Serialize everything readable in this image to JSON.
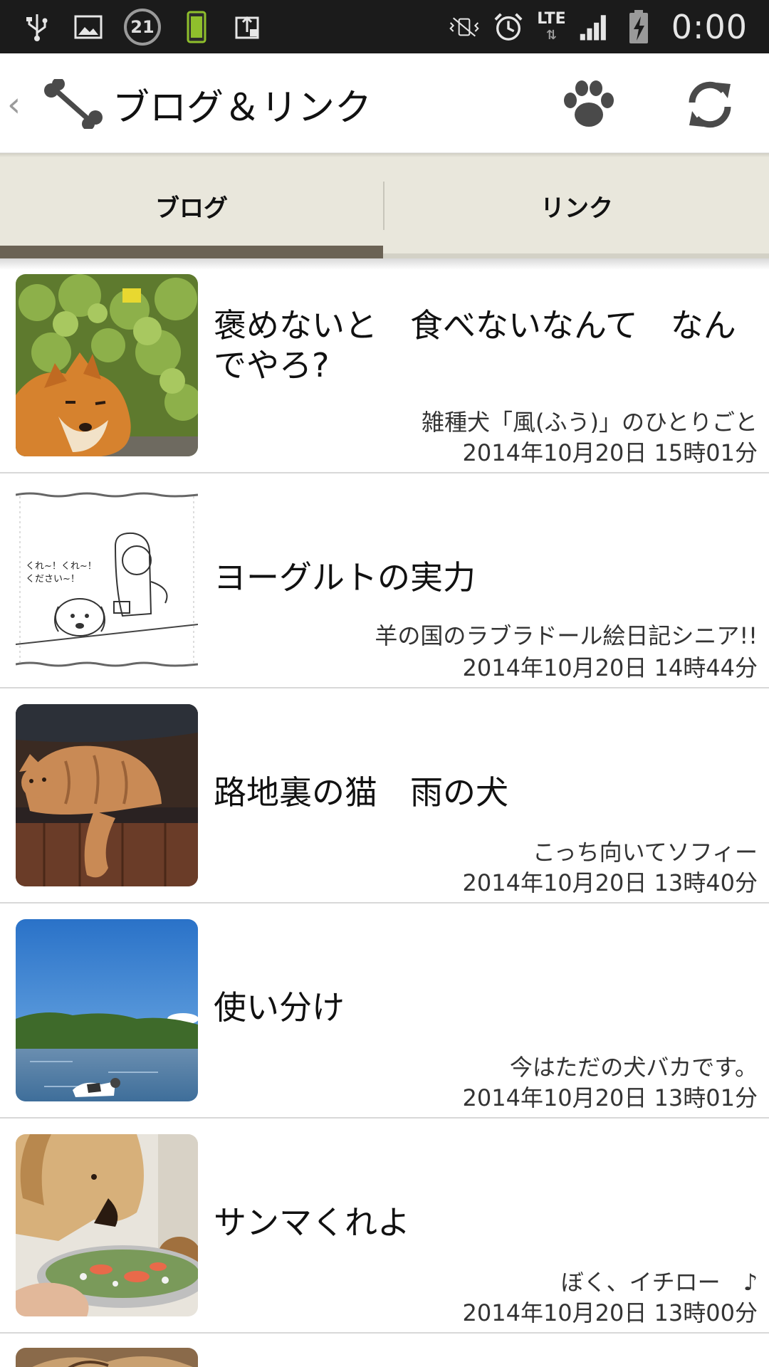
{
  "status_bar": {
    "notification_count": "21",
    "network": "LTE",
    "time": "0:00",
    "icons": [
      "usb-icon",
      "image-icon",
      "notification-count-badge",
      "battery-saver-icon",
      "screen-rotation-icon",
      "vibrate-off-icon",
      "alarm-icon",
      "lte-icon",
      "signal-icon",
      "battery-icon"
    ]
  },
  "action_bar": {
    "up_caret": "‹",
    "title": "ブログ＆リンク",
    "icons": [
      "bone-icon",
      "paw-icon",
      "refresh-icon"
    ]
  },
  "tabs": [
    {
      "label": "ブログ",
      "selected": true
    },
    {
      "label": "リンク",
      "selected": false
    }
  ],
  "items": [
    {
      "title": "褒めないと　食べないなんて　なんでやろ?",
      "blog": "雑種犬「風(ふう)」のひとりごと",
      "date": "2014年10月20日 15時01分"
    },
    {
      "title": "ヨーグルトの実力",
      "blog": "羊の国のラブラドール絵日記シニア!!",
      "date": "2014年10月20日 14時44分",
      "thumb_text": "くれ~！くれ~！\nください~！"
    },
    {
      "title": "路地裏の猫　雨の犬",
      "blog": "こっち向いてソフィー",
      "date": "2014年10月20日 13時40分"
    },
    {
      "title": "使い分け",
      "blog": "今はただの犬バカです。",
      "date": "2014年10月20日 13時01分"
    },
    {
      "title": "サンマくれよ",
      "blog": "ぼく、イチロー　♪",
      "date": "2014年10月20日 13時00分"
    }
  ],
  "colors": {
    "status_bar": "#1b1b1b",
    "tab_bar": "#e9e7dc",
    "tab_indicator": "#6b6355",
    "divider": "#d8d8d8"
  }
}
